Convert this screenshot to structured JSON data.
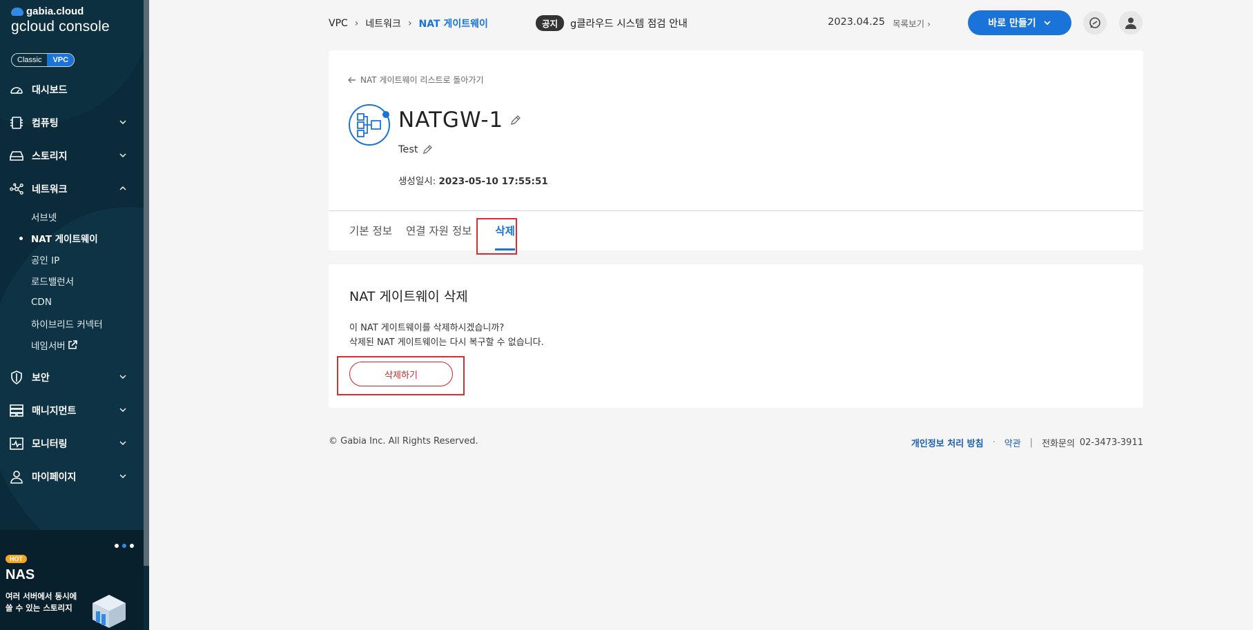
{
  "sidebar": {
    "brand_top": "gabia.cloud",
    "brand_console": "gcloud console",
    "mode_classic": "Classic",
    "mode_vpc": "VPC",
    "items": [
      {
        "label": "대시보드"
      },
      {
        "label": "컴퓨팅"
      },
      {
        "label": "스토리지"
      },
      {
        "label": "네트워크"
      },
      {
        "label": "보안"
      },
      {
        "label": "매니지먼트"
      },
      {
        "label": "모니터링"
      },
      {
        "label": "마이페이지"
      }
    ],
    "network_sub": [
      {
        "label": "서브넷"
      },
      {
        "label": "NAT 게이트웨이"
      },
      {
        "label": "공인 IP"
      },
      {
        "label": "로드밸런서"
      },
      {
        "label": "CDN"
      },
      {
        "label": "하이브리드 커넥터"
      },
      {
        "label": "네임서버"
      }
    ],
    "promo": {
      "badge": "HOT",
      "title": "NAS",
      "desc_line1": "여러 서버에서 동시에",
      "desc_line2": "쓸 수 있는 스토리지"
    }
  },
  "header": {
    "breadcrumb": [
      "VPC",
      "네트워크",
      "NAT 게이트웨이"
    ],
    "notice_badge": "공지",
    "notice_text": "g클라우드 시스템 점검 안내",
    "notice_date": "2023.04.25",
    "list_view": "목록보기",
    "make_button": "바로 만들기"
  },
  "detail": {
    "back_link": "NAT 게이트웨이 리스트로 돌아가기",
    "name": "NATGW-1",
    "description": "Test",
    "created_label": "생성일시:",
    "created_value": "2023-05-10 17:55:51",
    "tabs": [
      {
        "label": "기본 정보"
      },
      {
        "label": "연결 자원 정보"
      },
      {
        "label": "삭제"
      }
    ]
  },
  "delete": {
    "title": "NAT 게이트웨이 삭제",
    "msg_line1": "이 NAT 게이트웨이를 삭제하시겠습니까?",
    "msg_line2": "삭제된 NAT 게이트웨이는 다시 복구할 수 없습니다.",
    "button": "삭제하기"
  },
  "footer": {
    "copyright": "© Gabia Inc. All Rights Reserved.",
    "privacy": "개인정보 처리 방침",
    "terms": "약관",
    "phone_label": "전화문의",
    "phone": "02-3473-3911"
  }
}
